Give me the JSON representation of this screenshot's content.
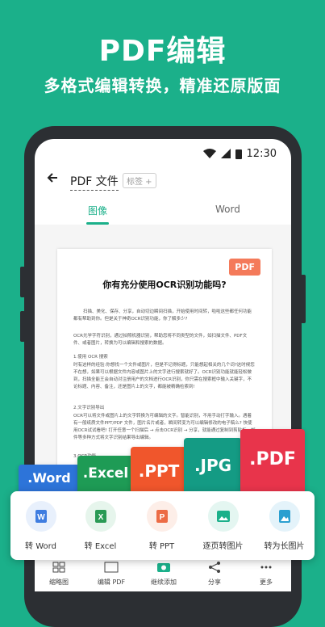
{
  "hero": {
    "title": "PDF编辑",
    "subtitle": "多格式编辑转换，精准还原版面"
  },
  "status_bar": {
    "time": "12:30"
  },
  "app_bar": {
    "title": "PDF 文件",
    "tag": "标签 +"
  },
  "tabs": [
    {
      "label": "图像"
    },
    {
      "label": "Word"
    }
  ],
  "document": {
    "badge": "PDF",
    "title": "你有充分使用OCR识别功能吗?",
    "paragraphs": [
      "扫描、美化、保存、分享，自动切边瞬间扫描，开始使用时间转，啦啦这些都任何功能都有帮助到你。但是关于神奇OCR识别功能，你了解多少?",
      "OCR光学字符识别，通过拍照机器识别，帮助您将不同类型的文件，如扫描文件、PDF文件、或者图片，转换为可以编辑和搜索的数据。",
      "1.使用 OCR 搜索",
      "时有这样的经验:你想找一个文件或图片，但是不记得标题，只能想起相关的几个词?这时候您不在想，如果可以根据文件内容或图片上的文字进行搜索就好了。OCR识别功能就能轻松做到，扫描全能王会自动对注册用户的文档进行OCR识别，你只需在搜索框中输入关键字，不论标题、内容、备注，还是图片上的文字，都能被精确检索到!",
      "2.文字识别导出",
      "OCR可以将文件或图片上的文字转换为可编辑的文字。智能识别，不用手动打字输入。遇着有一般纸质文件PPT/PDF 文件，图片名片或者，瞬间转变为可以编辑修改的电子稿么? 快使用OCR试试看吧! 打开任意一个扫描后 → 点击OCR识别 → 分享，就能通过复制到剪贴板，邮件等多种方式将文字识别结果导出编辑。",
      "3.OCR功能"
    ]
  },
  "bottom_nav": [
    {
      "label": "缩略图",
      "icon": "grid-icon"
    },
    {
      "label": "编辑 PDF",
      "icon": "pdf-edit-icon"
    },
    {
      "label": "继续添加",
      "icon": "camera-icon"
    },
    {
      "label": "分享",
      "icon": "share-icon"
    },
    {
      "label": "更多",
      "icon": "more-icon"
    }
  ],
  "format_chips": [
    {
      "label": ".Word",
      "color": "#2d74d9"
    },
    {
      "label": ".Excel",
      "color": "#1e9b55"
    },
    {
      "label": ".PPT",
      "color": "#f0562c"
    },
    {
      "label": ".JPG",
      "color": "#149b84"
    },
    {
      "label": ".PDF",
      "color": "#e8344b"
    }
  ],
  "actions": [
    {
      "label": "转 Word",
      "icon": "word-icon",
      "glyph": "W",
      "color": "#3f7de0",
      "bg": "#e8f0fc"
    },
    {
      "label": "转 Excel",
      "icon": "excel-icon",
      "glyph": "X",
      "color": "#2a9a55",
      "bg": "#e6f5ec"
    },
    {
      "label": "转 PPT",
      "icon": "ppt-icon",
      "glyph": "P",
      "color": "#ec6b45",
      "bg": "#fdeee8"
    },
    {
      "label": "逐页转图片",
      "icon": "image-icon",
      "glyph": "▲",
      "color": "#1bb08a",
      "bg": "#e4f6f1"
    },
    {
      "label": "转为长图片",
      "icon": "long-image-icon",
      "glyph": "▲",
      "color": "#2a9fd0",
      "bg": "#e4f3fa"
    }
  ]
}
